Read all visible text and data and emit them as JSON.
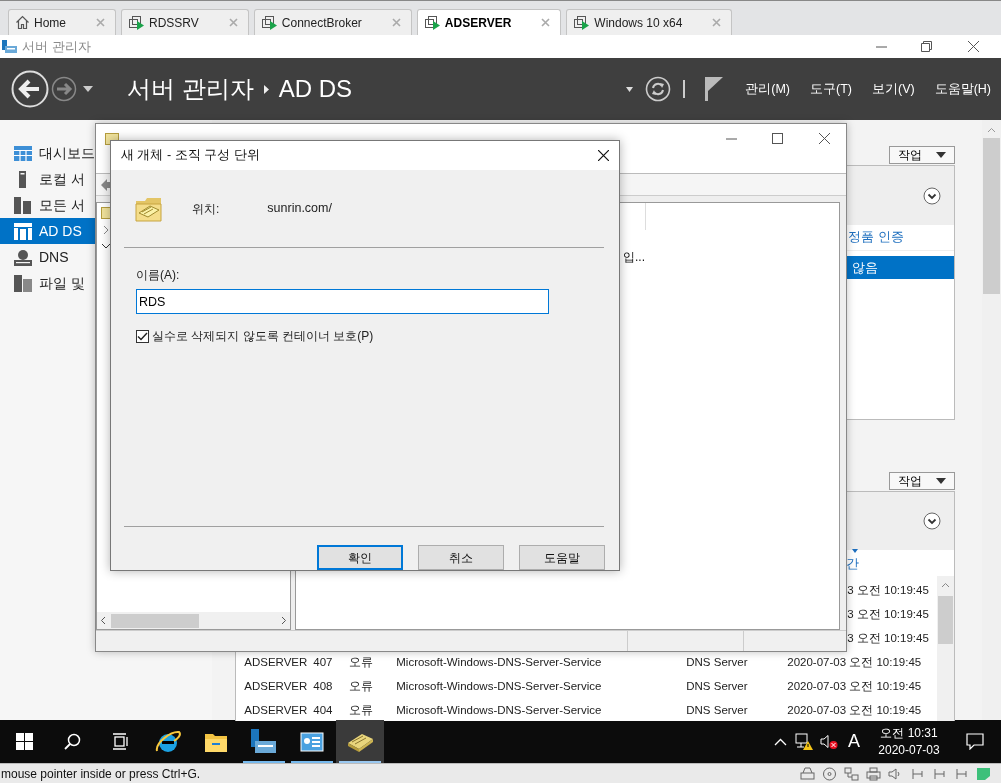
{
  "vm_tabs": [
    {
      "kind": "home",
      "label": "Home",
      "selected": false
    },
    {
      "kind": "vm",
      "label": "RDSSRV",
      "selected": false
    },
    {
      "kind": "vm",
      "label": "ConnectBroker",
      "selected": false
    },
    {
      "kind": "vm",
      "label": "ADSERVER",
      "selected": true
    },
    {
      "kind": "vm",
      "label": "Windows 10 x64",
      "selected": false
    }
  ],
  "window": {
    "title": "서버 관리자"
  },
  "header": {
    "breadcrumb": [
      "서버 관리자",
      "AD DS"
    ],
    "menus": [
      "관리(M)",
      "도구(T)",
      "보기(V)",
      "도움말(H)"
    ]
  },
  "sidebar": {
    "items": [
      {
        "kind": "dashboard",
        "label": "대시보드",
        "selected": false
      },
      {
        "kind": "local",
        "label": "로컬 서",
        "selected": false
      },
      {
        "kind": "all",
        "label": "모든 서",
        "selected": false
      },
      {
        "kind": "adds",
        "label": "AD DS",
        "selected": true
      },
      {
        "kind": "dns",
        "label": "DNS",
        "selected": false
      },
      {
        "kind": "file",
        "label": "파일 및",
        "selected": false
      }
    ]
  },
  "panels": [
    {
      "tasks_button": "작업",
      "column": "정품 인증",
      "rows": [
        {
          "cell": "않음",
          "selected": true
        }
      ]
    },
    {
      "tasks_button": "작업",
      "column": "간"
    }
  ],
  "events": {
    "partial_rows": [
      "3 오전 10:19:45",
      "3 오전 10:19:45",
      "3 오전 10:19:45"
    ],
    "rows": [
      [
        "ADSERVER",
        "407",
        "오류",
        "Microsoft-Windows-DNS-Server-Service",
        "DNS Server",
        "2020-07-03 오전 10:19:45"
      ],
      [
        "ADSERVER",
        "408",
        "오류",
        "Microsoft-Windows-DNS-Server-Service",
        "DNS Server",
        "2020-07-03 오전 10:19:45"
      ],
      [
        "ADSERVER",
        "404",
        "오류",
        "Microsoft-Windows-DNS-Server-Service",
        "DNS Server",
        "2020-07-03 오전 10:19:45"
      ]
    ]
  },
  "aduc_window": {
    "list_text": "입..."
  },
  "dialog": {
    "title": "새 개체 - 조직 구성 단위",
    "location_label": "위치:",
    "location": "sunrin.com/",
    "name_label": "이름(A):",
    "name_value": "RDS",
    "protect": {
      "label": "실수로 삭제되지 않도록 컨테이너 보호(P)",
      "checked": true
    },
    "buttons": [
      {
        "label": "확인",
        "default": true
      },
      {
        "label": "취소",
        "default": false
      },
      {
        "label": "도움말",
        "default": false
      }
    ]
  },
  "taskbar": {
    "apps": [
      {
        "kind": "start",
        "running": false,
        "selected": false
      },
      {
        "kind": "search",
        "running": false,
        "selected": false
      },
      {
        "kind": "taskview",
        "running": false,
        "selected": false
      },
      {
        "kind": "ie",
        "running": false,
        "selected": false
      },
      {
        "kind": "explorer",
        "running": false,
        "selected": false
      },
      {
        "kind": "servermanager",
        "running": true,
        "selected": false
      },
      {
        "kind": "aduc",
        "running": true,
        "selected": false
      },
      {
        "kind": "ou",
        "running": true,
        "selected": true
      }
    ],
    "ime": "A",
    "time": "오전 10:31",
    "date": "2020-07-03"
  },
  "vm_status": {
    "text": "mouse pointer inside or press Ctrl+G."
  }
}
